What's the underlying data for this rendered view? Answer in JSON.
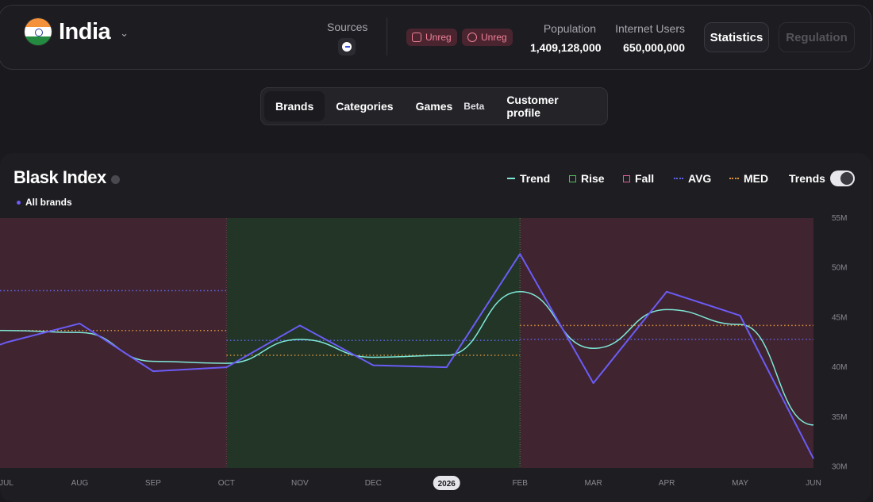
{
  "header": {
    "country": "India",
    "sources_label": "Sources",
    "badges": [
      "Unreg",
      "Unreg"
    ],
    "population_label": "Population",
    "population_value": "1,409,128,000",
    "internet_label": "Internet Users",
    "internet_value": "650,000,000",
    "statistics_label": "Statistics",
    "regulation_label": "Regulation"
  },
  "tabs": [
    {
      "label": "Brands",
      "active": true
    },
    {
      "label": "Categories",
      "active": false
    },
    {
      "label": "Games",
      "badge": "Beta",
      "active": false
    },
    {
      "label": "Customer profile",
      "active": false
    }
  ],
  "panel": {
    "title": "Blask Index",
    "subtitle": "All brands",
    "legend": {
      "trend": "Trend",
      "rise": "Rise",
      "fall": "Fall",
      "avg": "AVG",
      "med": "MED",
      "trends": "Trends"
    },
    "trends_on": true
  },
  "colors": {
    "series": "#6b5cf6",
    "trend": "#7ee8d8",
    "rise": "#4fbf5a",
    "fall": "#e0609a",
    "avg": "#5d63e8",
    "med": "#d9923a"
  },
  "chart_data": {
    "type": "line",
    "title": "Blask Index",
    "x": [
      "JUL",
      "AUG",
      "SEP",
      "OCT",
      "NOV",
      "DEC",
      "2026",
      "FEB",
      "MAR",
      "APR",
      "MAY",
      "JUN"
    ],
    "highlight_x": "2026",
    "series": [
      {
        "name": "All brands",
        "values": [
          42.5,
          44.4,
          39.6,
          40.0,
          44.2,
          40.2,
          40.0,
          51.4,
          38.4,
          47.6,
          45.2,
          30.8
        ]
      },
      {
        "name": "Trend",
        "values": [
          43.7,
          43.5,
          40.6,
          40.4,
          42.8,
          41.0,
          41.2,
          47.6,
          41.9,
          45.8,
          44.3,
          34.2
        ]
      }
    ],
    "y_ticks": [
      "55M",
      "50M",
      "45M",
      "40M",
      "35M",
      "30M"
    ],
    "ylim": [
      30,
      55
    ],
    "regions": [
      {
        "type": "fall",
        "from": "JUL",
        "to": "OCT",
        "avg": 47.7,
        "med": 43.7
      },
      {
        "type": "rise",
        "from": "OCT",
        "to": "FEB",
        "avg": 42.7,
        "med": 41.2
      },
      {
        "type": "fall",
        "from": "FEB",
        "to": "JUN",
        "avg": 42.8,
        "med": 44.2
      }
    ]
  }
}
